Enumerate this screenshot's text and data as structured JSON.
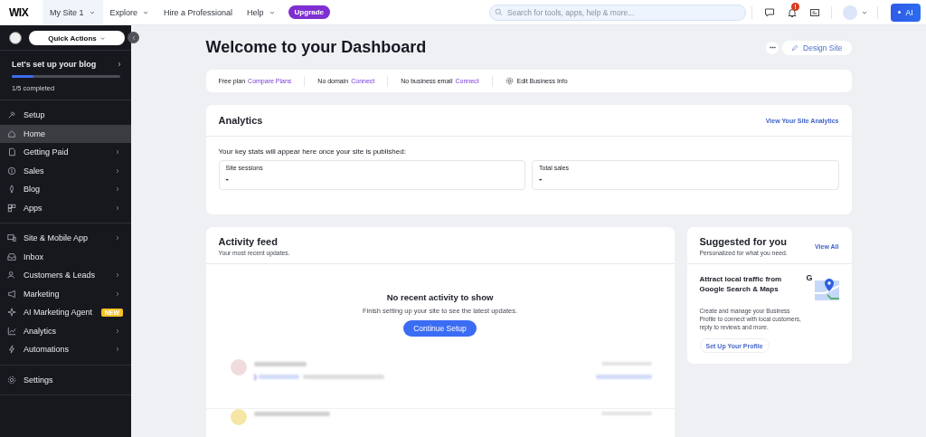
{
  "topbar": {
    "logo": "WIX",
    "site_menu": {
      "label": "My Site 1",
      "selected": true
    },
    "nav": [
      {
        "label": "Explore",
        "has_menu": true
      },
      {
        "label": "Hire a Professional",
        "has_menu": false
      },
      {
        "label": "Help",
        "has_menu": true
      }
    ],
    "upgrade": "Upgrade",
    "search": {
      "placeholder": "Search for tools, apps, help & more..."
    },
    "notification_badge": "!",
    "ai_button": "AI"
  },
  "sidebar": {
    "quick_actions": "Quick Actions",
    "setup": {
      "title": "Let's set up your blog",
      "level": 0.2,
      "progress": "1/5 completed"
    },
    "groups": [
      [
        {
          "label": "Setup",
          "selected": false,
          "has_submenu": false
        },
        {
          "label": "Home",
          "selected": true,
          "has_submenu": false
        },
        {
          "label": "Getting Paid",
          "selected": false,
          "has_submenu": true
        },
        {
          "label": "Sales",
          "selected": false,
          "has_submenu": true
        },
        {
          "label": "Blog",
          "selected": false,
          "has_submenu": true
        },
        {
          "label": "Apps",
          "selected": false,
          "has_submenu": true
        }
      ],
      [
        {
          "label": "Site & Mobile App",
          "selected": false,
          "has_submenu": true
        },
        {
          "label": "Inbox",
          "selected": false,
          "has_submenu": false
        },
        {
          "label": "Customers & Leads",
          "selected": false,
          "has_submenu": true
        },
        {
          "label": "Marketing",
          "selected": false,
          "has_submenu": true
        },
        {
          "label": "AI Marketing Agent",
          "selected": false,
          "has_submenu": false,
          "badge": "NEW"
        },
        {
          "label": "Analytics",
          "selected": false,
          "has_submenu": true
        },
        {
          "label": "Automations",
          "selected": false,
          "has_submenu": true
        }
      ],
      [
        {
          "label": "Settings",
          "selected": false,
          "has_submenu": false
        }
      ]
    ]
  },
  "page": {
    "title": "Welcome to your Dashboard",
    "design_button": "Design Site",
    "info_bar": [
      {
        "kind": "status",
        "label": "Free plan",
        "link": "Compare Plans"
      },
      {
        "kind": "status",
        "label": "No domain",
        "link": "Connect"
      },
      {
        "kind": "status",
        "label": "No business email",
        "link": "Connect"
      },
      {
        "kind": "action",
        "label": "Edit Business Info"
      }
    ],
    "analytics": {
      "title": "Analytics",
      "link": "View Your Site Analytics",
      "note": "Your key stats will appear here once your site is published:",
      "stats": [
        {
          "label": "Site sessions",
          "value": "-"
        },
        {
          "label": "Total sales",
          "value": "-"
        }
      ]
    },
    "activity_feed": {
      "title": "Activity feed",
      "subtitle": "Your most recent updates.",
      "empty_title": "No recent activity to show",
      "empty_text": "Finish setting up your site to see the latest updates.",
      "button": "Continue Setup",
      "blurred_rows": [
        {
          "color": "#f0dcdc"
        },
        {
          "color": "#f5e6a6"
        }
      ]
    },
    "suggested": {
      "title": "Suggested for you",
      "subtitle": "Personalized for what you need.",
      "view_all": "View All",
      "card": {
        "title": "Attract local traffic from Google Search & Maps",
        "text": "Create and manage your Business Profile to connect with local customers, reply to reviews and more.",
        "button": "Set Up Your Profile",
        "icon_letter": "G"
      }
    }
  }
}
